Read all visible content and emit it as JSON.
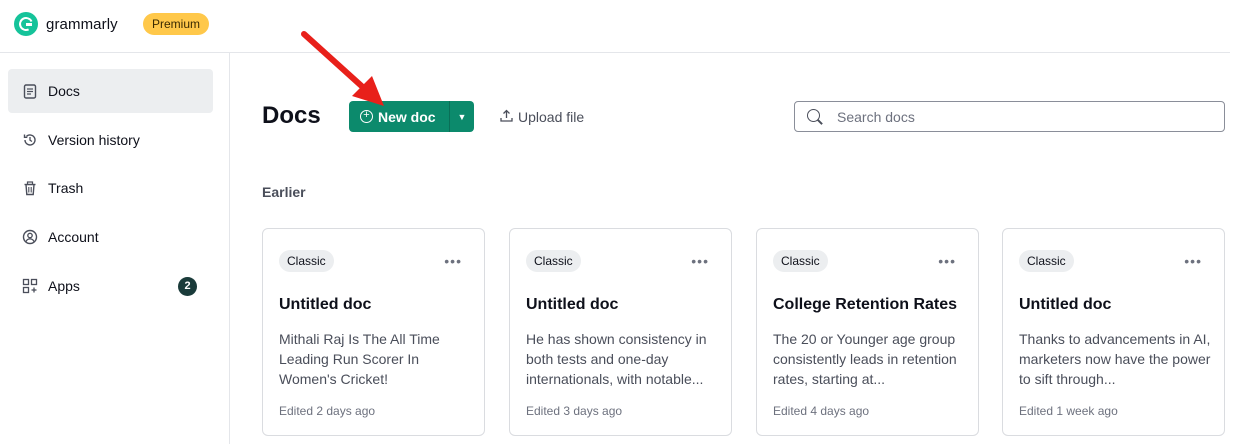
{
  "app": {
    "logo_text": "grammarly",
    "plan_badge": "Premium"
  },
  "sidebar": {
    "items": [
      {
        "label": "Docs",
        "icon": "document-icon",
        "active": true
      },
      {
        "label": "Version history",
        "icon": "history-icon"
      },
      {
        "label": "Trash",
        "icon": "trash-icon"
      },
      {
        "label": "Account",
        "icon": "account-icon"
      },
      {
        "label": "Apps",
        "icon": "apps-icon",
        "badge": "2"
      }
    ]
  },
  "header": {
    "title": "Docs",
    "new_doc_label": "New doc",
    "upload_label": "Upload file",
    "search_placeholder": "Search docs"
  },
  "section": {
    "label": "Earlier"
  },
  "docs": [
    {
      "tag": "Classic",
      "title": "Untitled doc",
      "preview": "Mithali Raj Is The All Time Leading Run Scorer In Women's Cricket!",
      "edited": "Edited 2 days ago"
    },
    {
      "tag": "Classic",
      "title": "Untitled doc",
      "preview": "He has shown consistency in both tests and one-day internationals, with notable...",
      "edited": "Edited 3 days ago"
    },
    {
      "tag": "Classic",
      "title": "College Retention Rates",
      "preview": "The 20 or Younger age group consistently leads in retention rates, starting at...",
      "edited": "Edited 4 days ago"
    },
    {
      "tag": "Classic",
      "title": "Untitled doc",
      "preview": "Thanks to advancements in AI, marketers now have the power to sift through...",
      "edited": "Edited 1 week ago"
    }
  ],
  "colors": {
    "brand_green": "#15c39a",
    "button_green": "#0c8a6c",
    "premium_yellow": "#ffc84a",
    "annotation_red": "#e8201a"
  }
}
